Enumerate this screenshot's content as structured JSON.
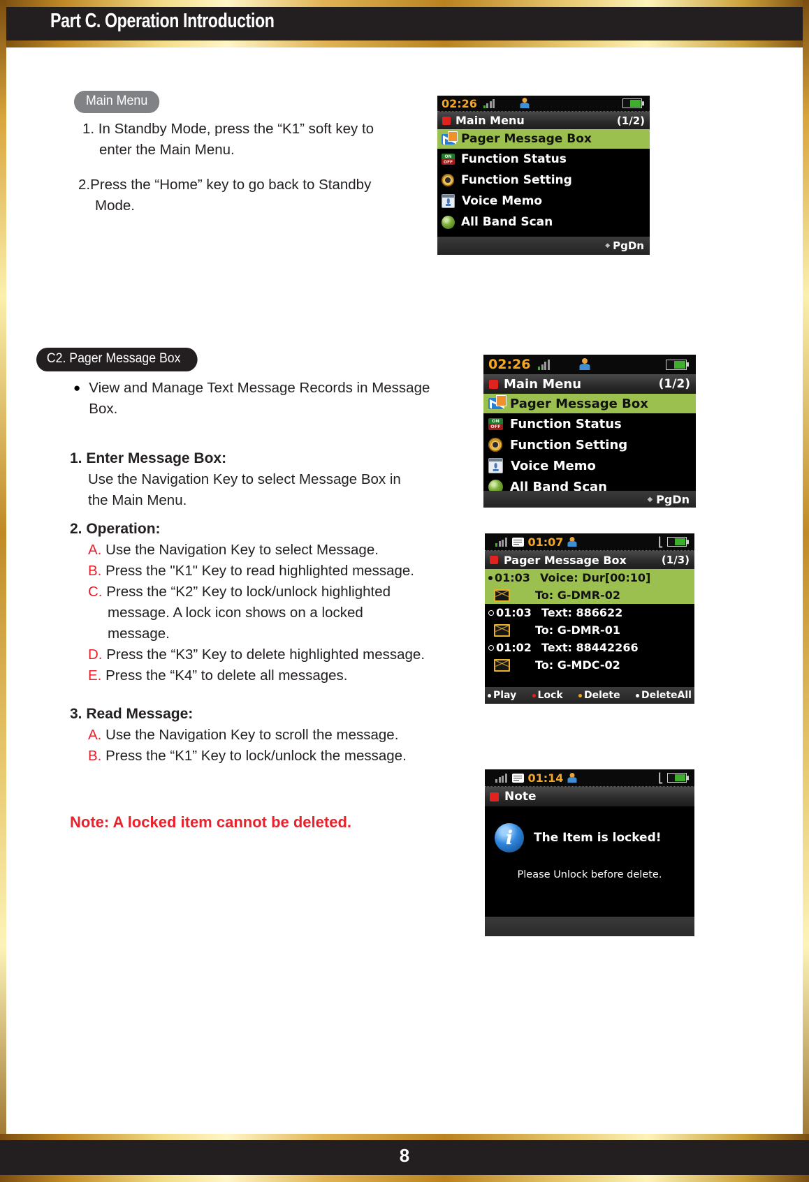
{
  "page": {
    "header_title": "Part C. Operation Introduction",
    "page_number": "8"
  },
  "section_main_menu": {
    "pill_label": "Main Menu",
    "step1": "1. In Standby Mode, press the “K1” soft key to",
    "step1_cont": "enter the Main Menu.",
    "step2": "2.Press the “Home” key to go back to Standby",
    "step2_cont": "Mode."
  },
  "section_c2": {
    "pill_label": "C2. Pager Message Box",
    "bullet": "View and Manage Text Message Records in Message Box.",
    "item1_heading": "1. Enter Message Box:",
    "item1_body_l1": "Use the Navigation Key to select Message Box in",
    "item1_body_l2": "the Main Menu.",
    "item2_heading": "2. Operation:",
    "item2_list": [
      {
        "letter": "A.",
        "text": "Use the Navigation Key to select Message."
      },
      {
        "letter": "B.",
        "text": "Press the \"K1\" Key to read highlighted message."
      },
      {
        "letter": "C.",
        "text": "Press the “K2” Key to lock/unlock highlighted"
      },
      {
        "letter": "",
        "text": "message. A lock icon shows on a locked"
      },
      {
        "letter": "",
        "text": "message."
      },
      {
        "letter": "D.",
        "text": "Press the “K3” Key to delete highlighted message."
      },
      {
        "letter": "E.",
        "text": "Press the “K4” to delete all messages."
      }
    ],
    "item3_heading": "3. Read Message:",
    "item3_list": [
      {
        "letter": "A.",
        "text": "Use the Navigation Key to scroll the message."
      },
      {
        "letter": "B.",
        "text": "Press the “K1” Key to lock/unlock the message."
      }
    ],
    "note": "Note: A locked item cannot be deleted."
  },
  "screens": {
    "main_menu_small": {
      "status": {
        "clock": "02:26",
        "signal_icon": "signal-bars-icon",
        "person_icon": "user-icon",
        "battery_icon": "battery-icon"
      },
      "title": "Main Menu",
      "page_indicator": "(1/2)",
      "items": [
        {
          "label": "Pager Message Box",
          "icon": "mail-box-icon",
          "selected": true
        },
        {
          "label": "Function Status",
          "icon": "on-off-icon",
          "selected": false
        },
        {
          "label": "Function Setting",
          "icon": "gear-icon",
          "selected": false
        },
        {
          "label": "Voice Memo",
          "icon": "voice-memo-icon",
          "selected": false
        },
        {
          "label": "All Band Scan",
          "icon": "globe-icon",
          "selected": false
        }
      ],
      "footer": "PgDn"
    },
    "main_menu_large": {
      "status": {
        "clock": "02:26",
        "signal_icon": "signal-bars-icon",
        "person_icon": "user-icon",
        "battery_icon": "battery-icon"
      },
      "title": "Main Menu",
      "page_indicator": "(1/2)",
      "items": [
        {
          "label": "Pager Message Box",
          "icon": "mail-box-icon",
          "selected": true
        },
        {
          "label": "Function Status",
          "icon": "on-off-icon",
          "selected": false
        },
        {
          "label": "Function Setting",
          "icon": "gear-icon",
          "selected": false
        },
        {
          "label": "Voice Memo",
          "icon": "voice-memo-icon",
          "selected": false
        },
        {
          "label": "All Band Scan",
          "icon": "globe-icon",
          "selected": false
        }
      ],
      "footer": "PgDn"
    },
    "message_box": {
      "status": {
        "clock": "01:07",
        "signal_icon": "signal-bars-icon",
        "message_icon": "message-icon",
        "person_icon": "user-icon",
        "plug_icon": "plug-icon",
        "battery_icon": "battery-icon"
      },
      "title": "Pager Message Box",
      "page_indicator": "(1/3)",
      "rows": [
        {
          "time": "01:03",
          "marker": "filled",
          "primary": "Voice: Dur[00:10]",
          "secondary": "To: G-DMR-02",
          "selected": true
        },
        {
          "time": "01:03",
          "marker": "hollow",
          "primary": "Text: 886622",
          "secondary": "To: G-DMR-01",
          "selected": false
        },
        {
          "time": "01:02",
          "marker": "hollow",
          "primary": "Text: 88442266",
          "secondary": "To: G-MDC-02",
          "selected": false
        }
      ],
      "softkeys": [
        {
          "label": "Play",
          "color": "#ffffff"
        },
        {
          "label": "Lock",
          "color": "#e0231f"
        },
        {
          "label": "Delete",
          "color": "#f5a623"
        },
        {
          "label": "DeleteAll",
          "color": "#ffffff"
        }
      ]
    },
    "note_dialog": {
      "status": {
        "clock": "01:14",
        "signal_icon": "signal-bars-icon",
        "message_icon": "message-icon",
        "person_icon": "user-icon",
        "plug_icon": "plug-icon",
        "battery_icon": "battery-icon"
      },
      "title": "Note",
      "info_icon": "info-icon",
      "message": "The Item is locked!",
      "submessage": "Please Unlock before delete."
    }
  }
}
